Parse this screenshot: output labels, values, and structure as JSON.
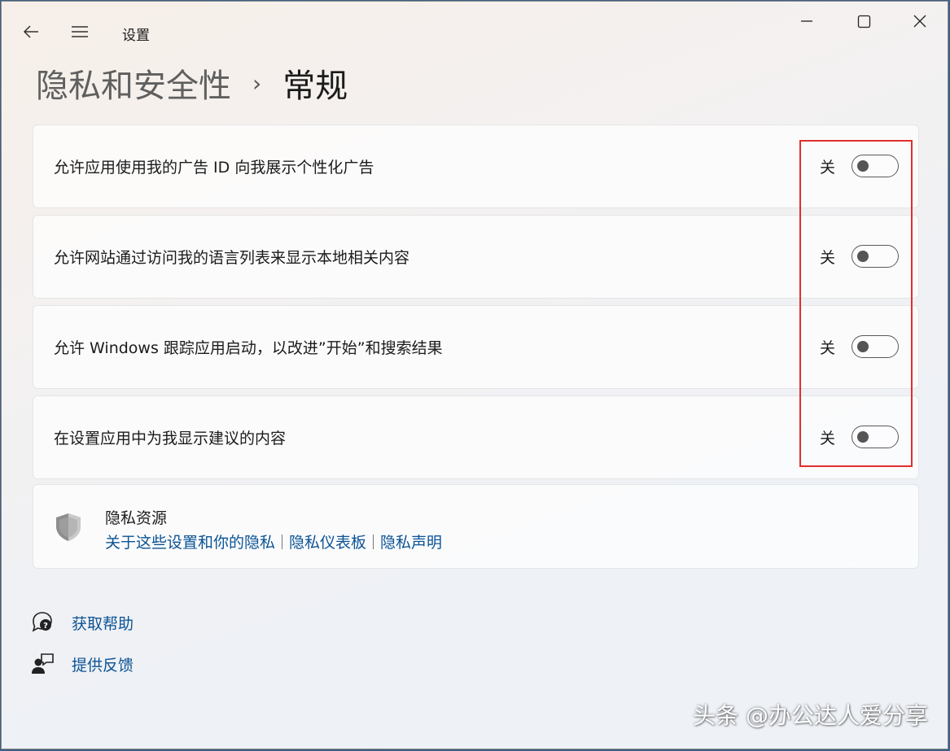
{
  "window": {
    "app_title": "设置",
    "back_icon": "back-arrow-icon",
    "menu_icon": "hamburger-menu-icon",
    "controls": [
      "minimize-icon",
      "maximize-icon",
      "close-icon"
    ]
  },
  "breadcrumb": {
    "parent": "隐私和安全性",
    "separator": "›",
    "current": "常规"
  },
  "settings": [
    {
      "label": "允许应用使用我的广告 ID 向我展示个性化广告",
      "state": "关",
      "on": false
    },
    {
      "label": "允许网站通过访问我的语言列表来显示本地相关内容",
      "state": "关",
      "on": false
    },
    {
      "label": "允许 Windows 跟踪应用启动，以改进”开始”和搜索结果",
      "state": "关",
      "on": false
    },
    {
      "label": "在设置应用中为我显示建议的内容",
      "state": "关",
      "on": false
    }
  ],
  "privacy_resources": {
    "icon": "shield-icon",
    "title": "隐私资源",
    "links": [
      "关于这些设置和你的隐私",
      "隐私仪表板",
      "隐私声明"
    ]
  },
  "help": {
    "get_help": "获取帮助",
    "feedback": "提供反馈"
  },
  "watermark": "头条 @办公达人爱分享",
  "colors": {
    "link": "#0b5394",
    "highlight": "#e0302b"
  }
}
